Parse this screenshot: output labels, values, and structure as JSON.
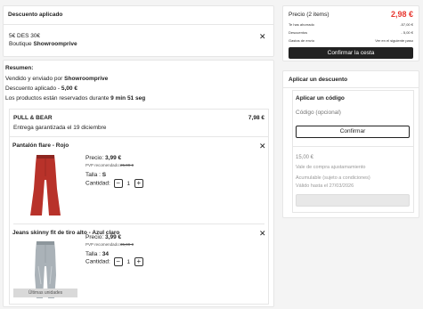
{
  "discount_panel": {
    "title": "Descuento aplicado",
    "code_line": "5€ DES 30€",
    "boutique_prefix": "Boutique ",
    "boutique_name": "Showroomprive"
  },
  "summary": {
    "title": "Resumen:",
    "sold_prefix": "Vendido y enviado por ",
    "sold_by": "Showroomprive",
    "discount_prefix": "Descuento aplicado - ",
    "discount_value": "5,00 €",
    "reserved_prefix": "Los productos están reservados durante ",
    "reserved_time": "9 min 51 seg"
  },
  "shop": {
    "name": "PULL & BEAR",
    "total": "7,98 €",
    "delivery": "Entrega garantizada el 19 diciembre"
  },
  "products": [
    {
      "name": "Pantalón flare - Rojo",
      "price_label": "Precio: ",
      "price": "3,99 €",
      "rrp_label": "PVP recomendado:",
      "rrp": "25,99 €",
      "size_label": "Talla : ",
      "size": "S",
      "qty_label": "Cantidad:",
      "qty_minus": "−",
      "qty": "1",
      "qty_plus": "+",
      "badge": "",
      "color": "#b8322a"
    },
    {
      "name": "Jeans skinny fit de tiro alto - Azul claro",
      "price_label": "Precio: ",
      "price": "3,99 €",
      "rrp_label": "PVP recomendado:",
      "rrp": "35,99 €",
      "size_label": "Talla : ",
      "size": "34",
      "qty_label": "Cantidad:",
      "qty_minus": "−",
      "qty": "1",
      "qty_plus": "+",
      "badge": "Últimas unidades",
      "color": "#aab2b8"
    }
  ],
  "order": {
    "price_label": "Precio (2 items)",
    "price_total": "2,98 €",
    "lines": [
      {
        "label": "Te has ahorrado",
        "value": "-57,00 €"
      },
      {
        "label": "Descuentos",
        "value": "- 5,00 €"
      },
      {
        "label": "Gastos de envío",
        "value": "Ver en el siguiente paso"
      }
    ],
    "confirm_label": "Confirmar la cesta"
  },
  "apply_discount": {
    "title": "Aplicar un descuento",
    "code_title": "Aplicar un código",
    "placeholder": "Código (opcional)",
    "confirm_label": "Confirmar",
    "voucher_amount": "15,00 €",
    "voucher_desc": "Vale de compra ajustamamiento",
    "voucher_note": "Acumulable (sujeto a condiciones)",
    "voucher_valid": "Válido hasta el 27/03/2026"
  },
  "colors": {
    "price_total": "#e8372f",
    "dark_button": "#222222"
  }
}
